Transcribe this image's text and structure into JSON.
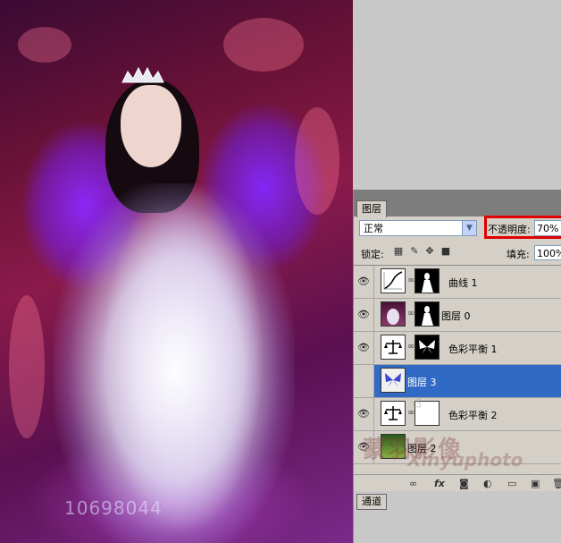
{
  "canvas": {
    "watermark_text": "10698044"
  },
  "panel": {
    "tab_layers": "图层",
    "blend_mode": "正常",
    "opacity_label": "不透明度:",
    "opacity_value": "70%",
    "lock_label": "锁定:",
    "fill_label": "填充:",
    "fill_value": "100%",
    "watermark_cn": "蒙羽影像",
    "watermark_en": "Xinyuphoto",
    "channels_tab": "通道",
    "layers": [
      {
        "name": "曲线 1",
        "type": "curves-adjustment",
        "has_mask": true
      },
      {
        "name": "图层 0",
        "type": "pixel",
        "has_mask": true
      },
      {
        "name": "色彩平衡 1",
        "type": "color-balance-adjustment",
        "has_mask": true
      },
      {
        "name": "图层 3",
        "type": "pixel",
        "has_mask": false,
        "selected": true
      },
      {
        "name": "色彩平衡 2",
        "type": "color-balance-adjustment",
        "has_mask": true
      },
      {
        "name": "图层 2",
        "type": "pixel",
        "has_mask": false
      }
    ]
  },
  "colors": {
    "selection": "#316ac5",
    "highlight_border": "#e00000",
    "panel_bg": "#d4d0c8"
  }
}
